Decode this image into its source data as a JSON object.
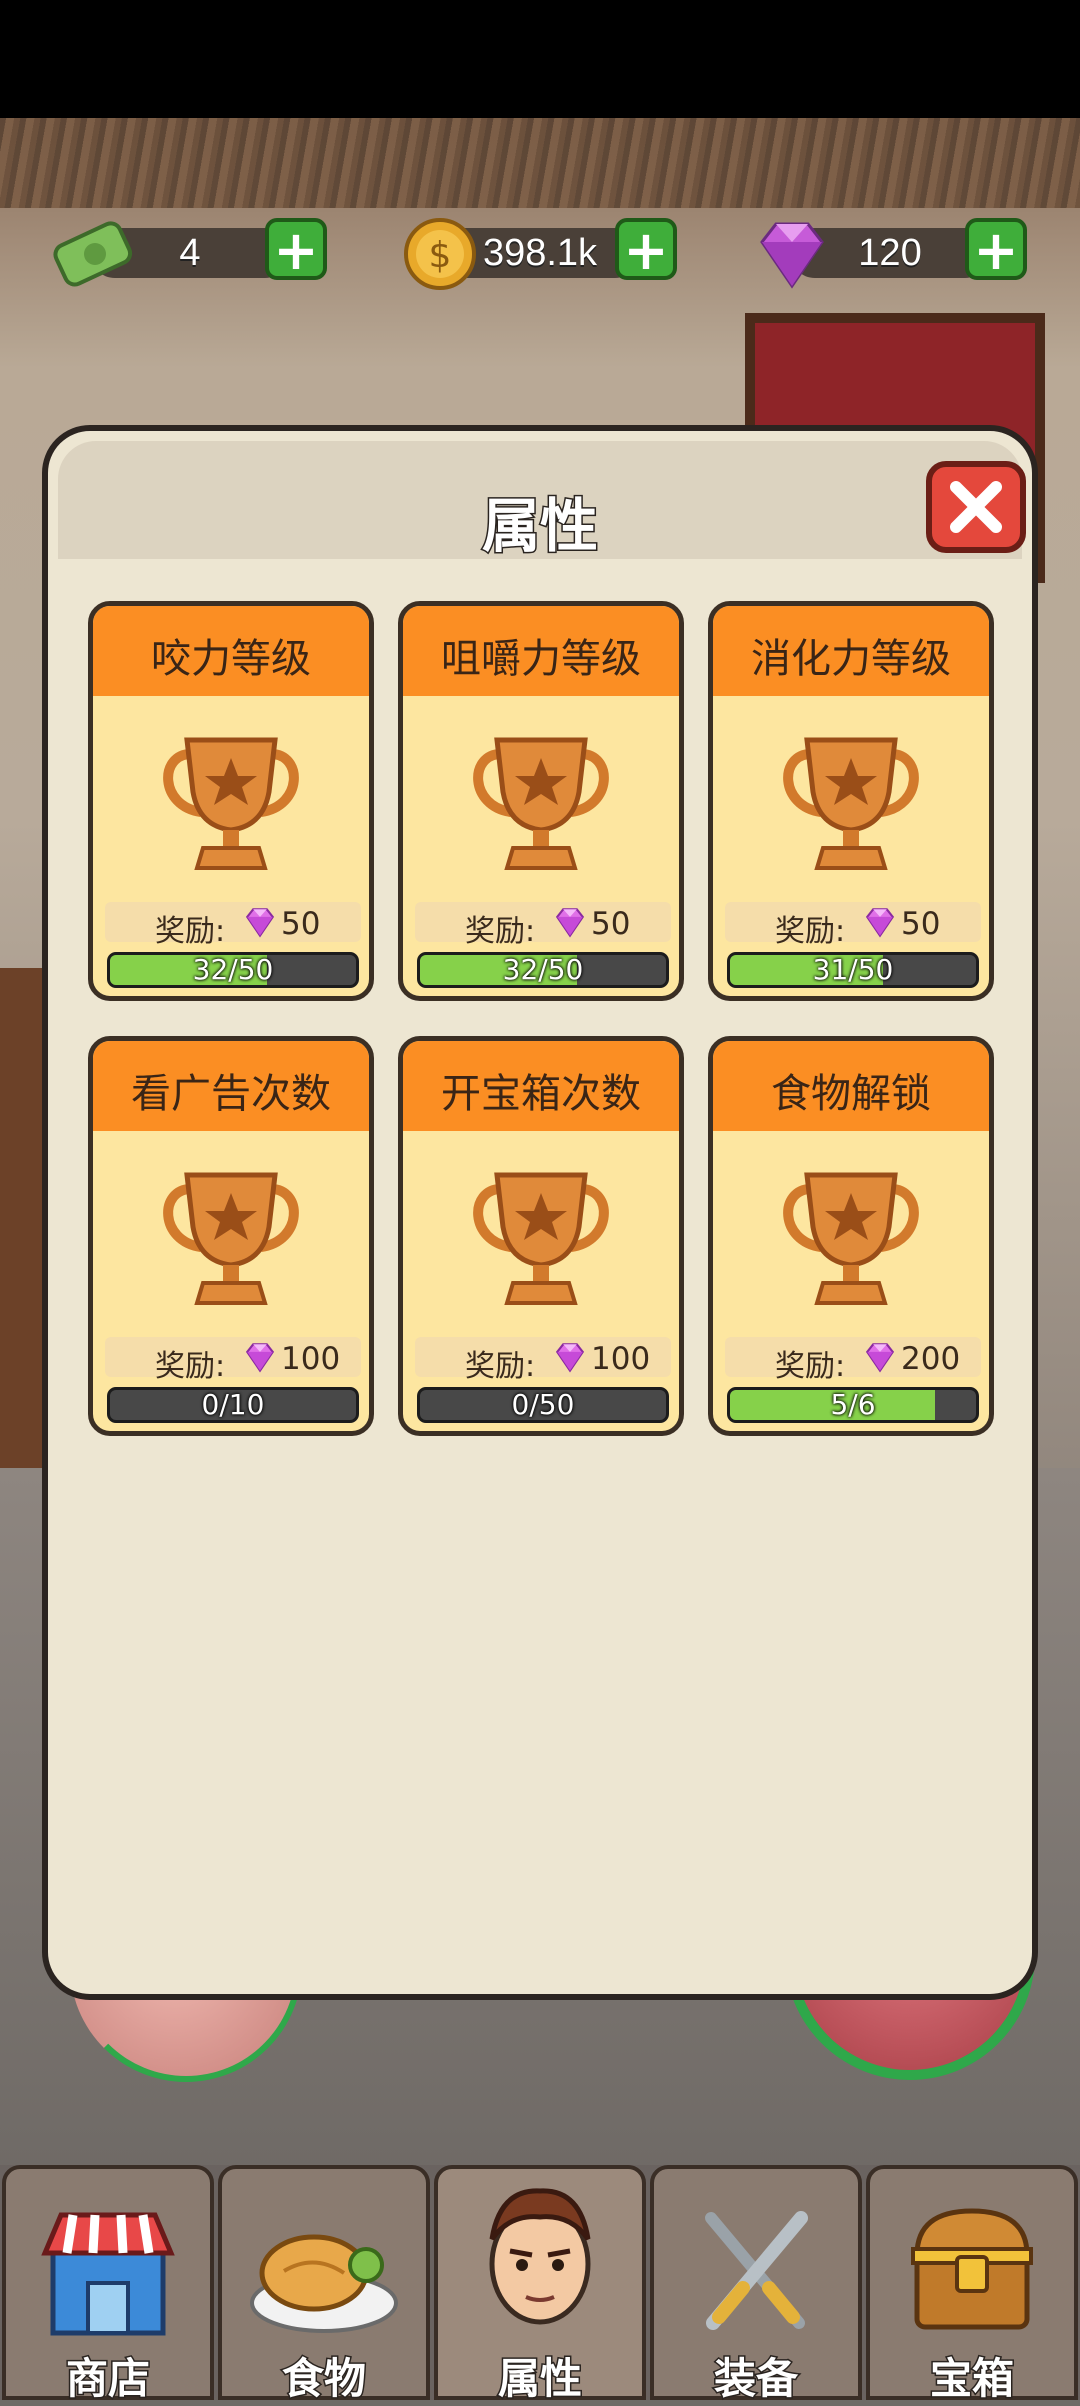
{
  "resources": [
    {
      "name": "cash",
      "value": "4"
    },
    {
      "name": "coin",
      "value": "398.1k"
    },
    {
      "name": "gem",
      "value": "120"
    }
  ],
  "dialog": {
    "title": "属性",
    "cards": [
      {
        "title": "咬力等级",
        "reward_label": "奖励:",
        "reward": "50",
        "progress_text": "32/50",
        "progress": 0.64
      },
      {
        "title": "咀嚼力等级",
        "reward_label": "奖励:",
        "reward": "50",
        "progress_text": "32/50",
        "progress": 0.64
      },
      {
        "title": "消化力等级",
        "reward_label": "奖励:",
        "reward": "50",
        "progress_text": "31/50",
        "progress": 0.62
      },
      {
        "title": "看广告次数",
        "reward_label": "奖励:",
        "reward": "100",
        "progress_text": "0/10",
        "progress": 0.0
      },
      {
        "title": "开宝箱次数",
        "reward_label": "奖励:",
        "reward": "100",
        "progress_text": "0/50",
        "progress": 0.0
      },
      {
        "title": "食物解锁",
        "reward_label": "奖励:",
        "reward": "200",
        "progress_text": "5/6",
        "progress": 0.833
      }
    ]
  },
  "nav": {
    "tabs": [
      {
        "label": "商店",
        "icon": "shop-icon"
      },
      {
        "label": "食物",
        "icon": "food-icon"
      },
      {
        "label": "属性",
        "icon": "character-icon",
        "active": true
      },
      {
        "label": "装备",
        "icon": "equipment-icon"
      },
      {
        "label": "宝箱",
        "icon": "chest-icon"
      }
    ]
  },
  "colors": {
    "card_header": "#fb8e23",
    "card_body": "#fde6a0",
    "progress_fill": "#86d14a",
    "close_button": "#e4483c",
    "plus_button": "#3fae3a"
  }
}
